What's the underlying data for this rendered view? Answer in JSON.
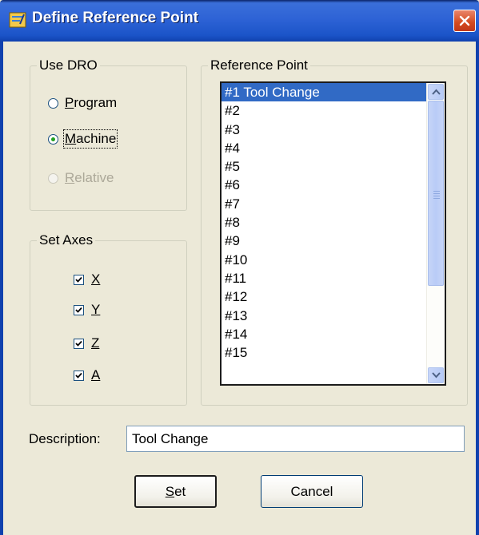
{
  "window": {
    "title": "Define Reference Point",
    "close_icon": "close-icon",
    "app_icon": "app-icon"
  },
  "use_dro": {
    "label": "Use DRO",
    "options": [
      {
        "mnemonic": "P",
        "rest": "rogram",
        "checked": false,
        "enabled": true
      },
      {
        "mnemonic": "M",
        "rest": "achine",
        "checked": true,
        "enabled": true
      },
      {
        "mnemonic": "R",
        "rest": "elative",
        "checked": false,
        "enabled": false
      }
    ]
  },
  "set_axes": {
    "label": "Set Axes",
    "axes": [
      {
        "label": "X",
        "checked": true
      },
      {
        "label": "Y",
        "checked": true
      },
      {
        "label": "Z",
        "checked": true
      },
      {
        "label": "A",
        "checked": true
      }
    ]
  },
  "reference_point": {
    "label": "Reference Point",
    "items": [
      "#1 Tool Change",
      "#2",
      "#3",
      "#4",
      "#5",
      "#6",
      "#7",
      "#8",
      "#9",
      "#10",
      "#11",
      "#12",
      "#13",
      "#14",
      "#15"
    ],
    "selected_index": 0
  },
  "description": {
    "label": "Description:",
    "value": "Tool Change"
  },
  "buttons": {
    "set_mnemonic": "S",
    "set_rest": "et",
    "cancel": "Cancel"
  },
  "colors": {
    "selection": "#316AC5",
    "titlebar": "#2E63D6",
    "dialog_bg": "#ECE9D8",
    "close": "#D44A1E"
  }
}
